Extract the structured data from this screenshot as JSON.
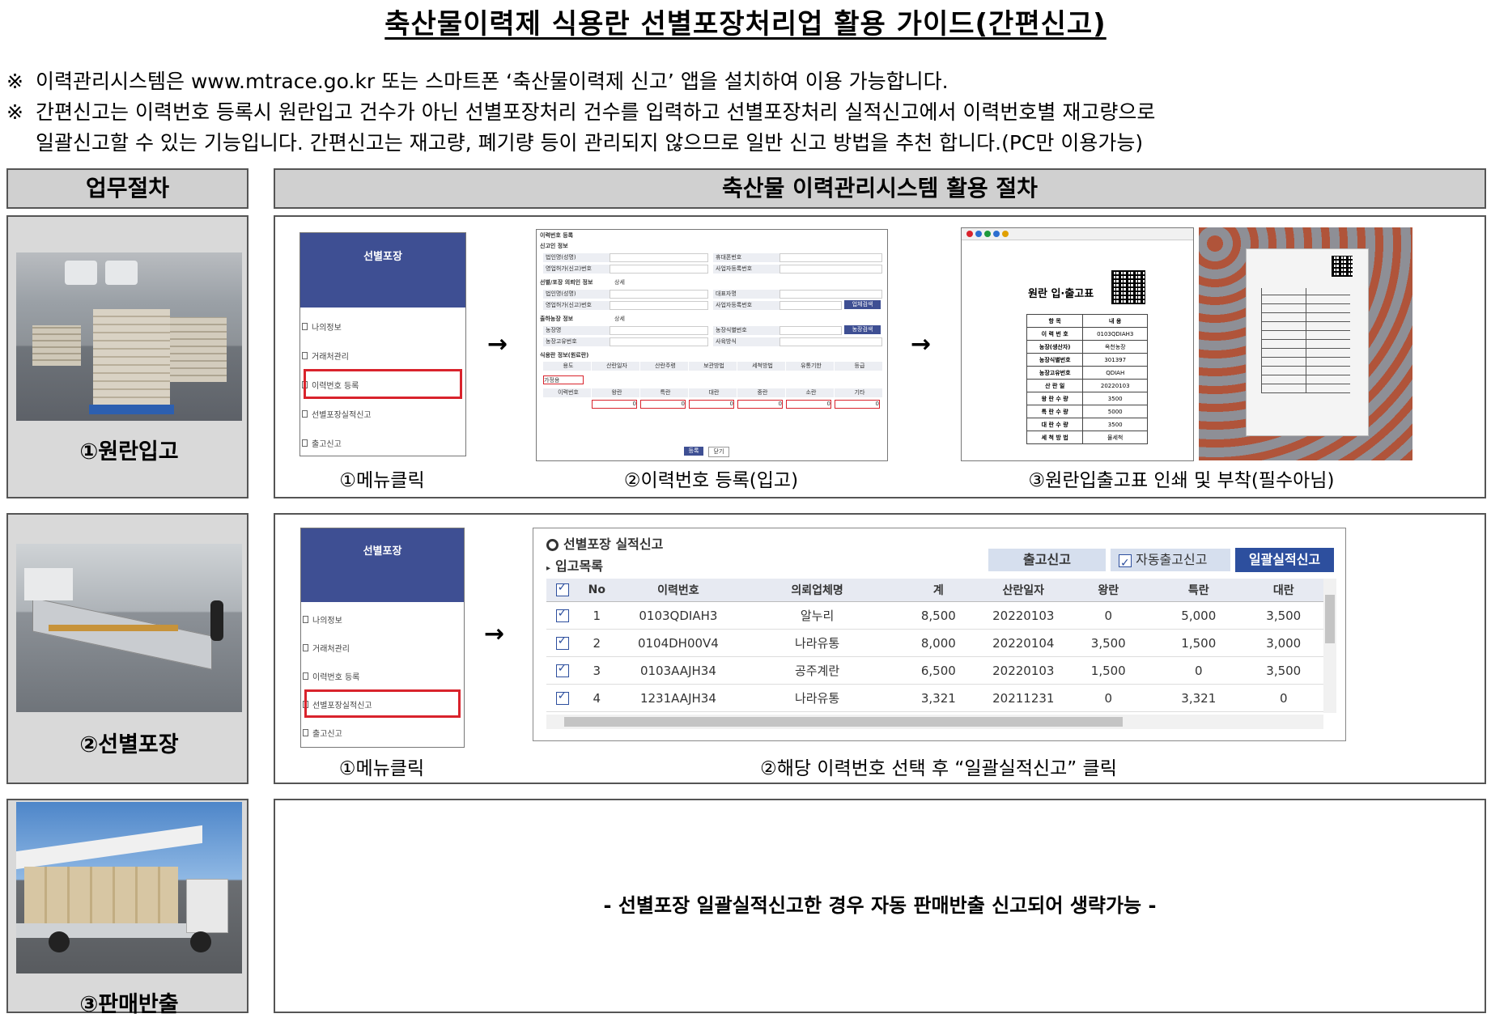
{
  "title": "축산물이력제 식용란 선별포장처리업 활용 가이드(간편신고)",
  "notes": {
    "mark": "※",
    "line1": "이력관리시스템은 www.mtrace.go.kr 또는 스마트폰 ‘축산물이력제 신고’ 앱을 설치하여 이용 가능합니다.",
    "line2a": "간편신고는 이력번호 등록시 원란입고 건수가 아닌 선별포장처리 건수를 입력하고 선별포장처리 실적신고에서 이력번호별 재고량으로",
    "line2b": "일괄신고할 수 있는 기능입니다. 간편신고는 재고량, 폐기량 등이 관리되지 않으므로 일반 신고 방법을 추천 합니다.(PC만 이용가능)"
  },
  "headers": {
    "left": "업무절차",
    "right": "축산물 이력관리시스템 활용 절차"
  },
  "steps": [
    {
      "label": "①원란입고"
    },
    {
      "label": "②선별포장"
    },
    {
      "label": "③판매반출"
    }
  ],
  "menu": {
    "header": "선별포장",
    "items": [
      "나의정보",
      "거래처관리",
      "이력번호 등록",
      "선별포장실적신고",
      "출고신고"
    ]
  },
  "arrow": "→",
  "row1": {
    "captions": [
      "①메뉴클릭",
      "②이력번호 등록(입고)",
      "③원란입출고표 인쇄 및 부착(필수아님)"
    ],
    "form": {
      "title": "이력번호 등록",
      "sec1": "신고인 정보",
      "sec2": "선별/포장 의뢰인 정보",
      "sec3": "출하농장 정보",
      "sec4": "식용란 정보(원료란)",
      "same": "상세",
      "f1": "법인명(성명)",
      "f2": "휴대폰번호",
      "f3": "영업허가(신고)번호",
      "f4": "사업자등록번호",
      "f5": "법인명(성명)",
      "f6": "대표자명",
      "f7": "영업허가(신고)번호",
      "f8": "사업자등록번호",
      "btn1": "업체검색",
      "f9": "농장명",
      "f10": "농장식별번호",
      "f11": "농장고유번호",
      "f12": "사육방식",
      "btn2": "농장검색",
      "cols1": [
        "용도",
        "산란일자",
        "산란주령",
        "보관방법",
        "세척방법",
        "유통기한",
        "등급"
      ],
      "use": "가정용",
      "cols2": [
        "이력번호",
        "왕란",
        "특란",
        "대란",
        "중란",
        "소란",
        "기타"
      ],
      "zero": "0",
      "btn_reg": "등록",
      "btn_close": "닫기"
    },
    "slip": {
      "title": "원란 입·출고표",
      "head": [
        "항 목",
        "내 용"
      ],
      "rows": [
        [
          "이 력 번 호",
          "0103QDIAH3"
        ],
        [
          "농장(생산자)",
          "옥천농장"
        ],
        [
          "농장식별번호",
          "301397"
        ],
        [
          "농장고유번호",
          "QDIAH"
        ],
        [
          "산 란 일",
          "20220103"
        ],
        [
          "왕 란 수 량",
          "3500"
        ],
        [
          "특 란 수 량",
          "5000"
        ],
        [
          "대 란 수 량",
          "3500"
        ],
        [
          "세 척 방 법",
          "물세척"
        ]
      ]
    }
  },
  "row2": {
    "captions": [
      "①메뉴클릭",
      "②해당 이력번호 선택 후 “일괄실적신고” 클릭"
    ],
    "panel_title": "선별포장 실적신고",
    "list_title": "입고목록",
    "btn_out": "출고신고",
    "auto_label": "자동출고신고",
    "btn_bulk": "일괄실적신고",
    "columns": [
      "No",
      "이력번호",
      "의뢰업체명",
      "계",
      "산란일자",
      "왕란",
      "특란",
      "대란"
    ],
    "rows": [
      [
        "1",
        "0103QDIAH3",
        "알누리",
        "8,500",
        "20220103",
        "0",
        "5,000",
        "3,500"
      ],
      [
        "2",
        "0104DH00V4",
        "나라유통",
        "8,000",
        "20220104",
        "3,500",
        "1,500",
        "3,000"
      ],
      [
        "3",
        "0103AAJH34",
        "공주계란",
        "6,500",
        "20220103",
        "1,500",
        "0",
        "3,500"
      ],
      [
        "4",
        "1231AAJH34",
        "나라유통",
        "3,321",
        "20211231",
        "0",
        "3,321",
        "0"
      ]
    ]
  },
  "row3": {
    "message": "- 선별포장 일괄실적신고한 경우 자동 판매반출 신고되어 생략가능 -"
  },
  "colors": {
    "header_gray": "#d0d0d0",
    "menu_blue": "#3e4f93",
    "highlight_red": "#d9232c",
    "button_navy": "#2d4f9e"
  }
}
